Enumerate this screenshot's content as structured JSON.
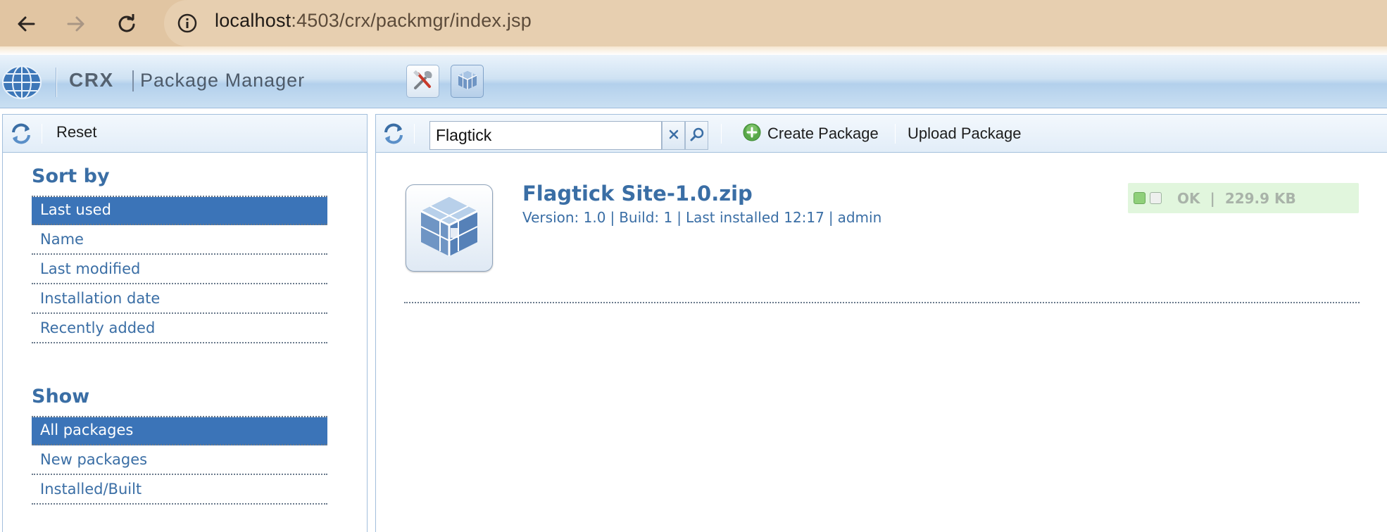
{
  "browser": {
    "url_host": "localhost",
    "url_rest": ":4503/crx/packmgr/index.jsp"
  },
  "app": {
    "title_crx": "CRX",
    "title_pm": "Package Manager"
  },
  "left_panel": {
    "reset_label": "Reset",
    "sort_title": "Sort by",
    "sort_options": [
      "Last used",
      "Name",
      "Last modified",
      "Installation date",
      "Recently added"
    ],
    "sort_selected": "Last used",
    "show_title": "Show",
    "show_options": [
      "All packages",
      "New packages",
      "Installed/Built"
    ],
    "show_selected": "All packages"
  },
  "toolbar": {
    "search_value": "Flagtick",
    "create_label": "Create Package",
    "upload_label": "Upload Package"
  },
  "package": {
    "name": "Flagtick Site-1.0.zip",
    "version": "Version: 1.0",
    "build": "Build: 1",
    "installed": "Last installed 12:17",
    "user": "admin",
    "status": "OK",
    "size": "229.9 KB"
  },
  "colors": {
    "accent": "#3a6ea5",
    "selected_bg": "#3b74b8",
    "status_bg": "#e1f6dd",
    "browser_bar": "#e1c5a2"
  },
  "icons": [
    "back-arrow-icon",
    "forward-arrow-icon",
    "reload-icon",
    "info-icon",
    "globe-logo-icon",
    "tools-icon",
    "package-icon",
    "refresh-icon",
    "clear-icon",
    "search-icon",
    "add-icon",
    "package-cube-icon"
  ]
}
